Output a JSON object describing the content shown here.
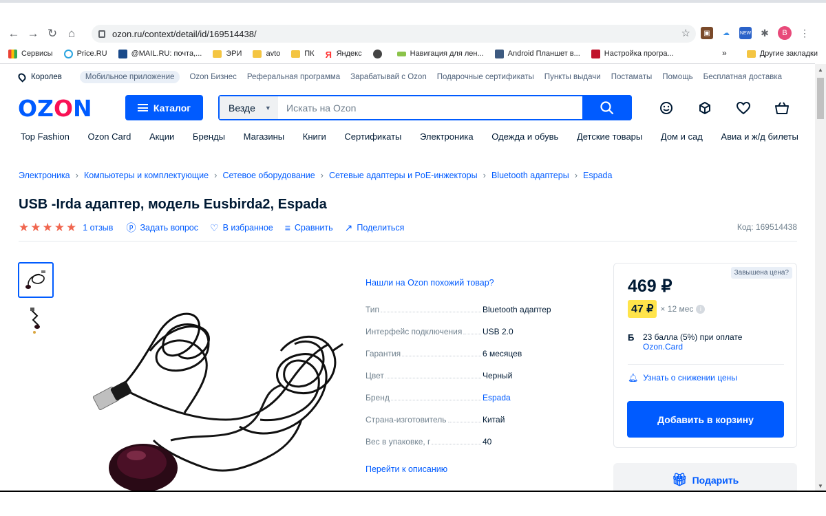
{
  "browser": {
    "url": "ozon.ru/context/detail/id/169514438/",
    "profile_initial": "B",
    "bookmarks": [
      {
        "label": "Сервисы",
        "icon": "apps-grid-icon"
      },
      {
        "label": "Price.RU",
        "icon": "price-ru-icon"
      },
      {
        "label": "@MAIL.RU: почта,...",
        "icon": "mail-ru-icon"
      },
      {
        "label": "ЭРИ",
        "icon": "folder-icon"
      },
      {
        "label": "avto",
        "icon": "folder-icon"
      },
      {
        "label": "ПК",
        "icon": "folder-icon"
      },
      {
        "label": "Яндекс",
        "icon": "yandex-icon"
      },
      {
        "label": "",
        "icon": "globe-icon"
      },
      {
        "label": "Навигация для лен...",
        "icon": "nav-icon"
      },
      {
        "label": "Android Планшет в...",
        "icon": "gt-icon"
      },
      {
        "label": "Настройка програ...",
        "icon": "d-icon"
      }
    ],
    "bookmarks_more": "»",
    "other_bookmarks": "Другие закладки"
  },
  "topline": {
    "location": "Королев",
    "app_pill": "Мобильное приложение",
    "links": [
      "Ozon Бизнес",
      "Реферальная программа",
      "Зарабатывай с Ozon",
      "Подарочные сертификаты",
      "Пункты выдачи",
      "Постаматы",
      "Помощь",
      "Бесплатная доставка"
    ]
  },
  "header": {
    "logo_parts": [
      "OZ",
      "O",
      "N"
    ],
    "catalog_label": "Каталог",
    "search_scope": "Везде",
    "search_placeholder": "Искать на Ozon"
  },
  "catnav": [
    "Top Fashion",
    "Ozon Card",
    "Акции",
    "Бренды",
    "Магазины",
    "Книги",
    "Сертификаты",
    "Электроника",
    "Одежда и обувь",
    "Детские товары",
    "Дом и сад",
    "Авиа и ж/д билеты"
  ],
  "breadcrumb": [
    "Электроника",
    "Компьютеры и комплектующие",
    "Сетевое оборудование",
    "Сетевые адаптеры и PoE-инжекторы",
    "Bluetooth адаптеры",
    "Espada"
  ],
  "product": {
    "title": "USB -Irda адаптер, модель Eusbirda2, Espada",
    "rating": 5,
    "reviews": "1 отзыв",
    "ask": "Задать вопрос",
    "favorite": "В избранное",
    "compare": "Сравнить",
    "share": "Поделиться",
    "code": "Код: 169514438",
    "similar": "Нашли на Ozon похожий товар?",
    "to_description": "Перейти к описанию",
    "specs": [
      {
        "k": "Тип",
        "v": "Bluetooth адаптер",
        "link": false
      },
      {
        "k": "Интерфейс подключения",
        "v": "USB 2.0",
        "link": false
      },
      {
        "k": "Гарантия",
        "v": "6 месяцев",
        "link": false
      },
      {
        "k": "Цвет",
        "v": "Черный",
        "link": false
      },
      {
        "k": "Бренд",
        "v": "Espada",
        "link": true
      },
      {
        "k": "Страна-изготовитель",
        "v": "Китай",
        "link": false
      },
      {
        "k": "Вес в упаковке, г",
        "v": "40",
        "link": false
      }
    ]
  },
  "price_card": {
    "overpriced": "Завышена цена?",
    "price": "469 ₽",
    "installment": "47 ₽",
    "installment_term": "× 12 мес",
    "bonus_letter": "Б",
    "bonus_text": "23 балла (5%) при оплате",
    "bonus_link": "Ozon.Card",
    "notify": "Узнать о снижении цены",
    "add_to_cart": "Добавить в корзину",
    "gift": "Подарить"
  },
  "colors": {
    "brand": "#005bff",
    "accent_red": "#f91155",
    "star": "#f0664f",
    "installment_bg": "#ffe44a"
  }
}
